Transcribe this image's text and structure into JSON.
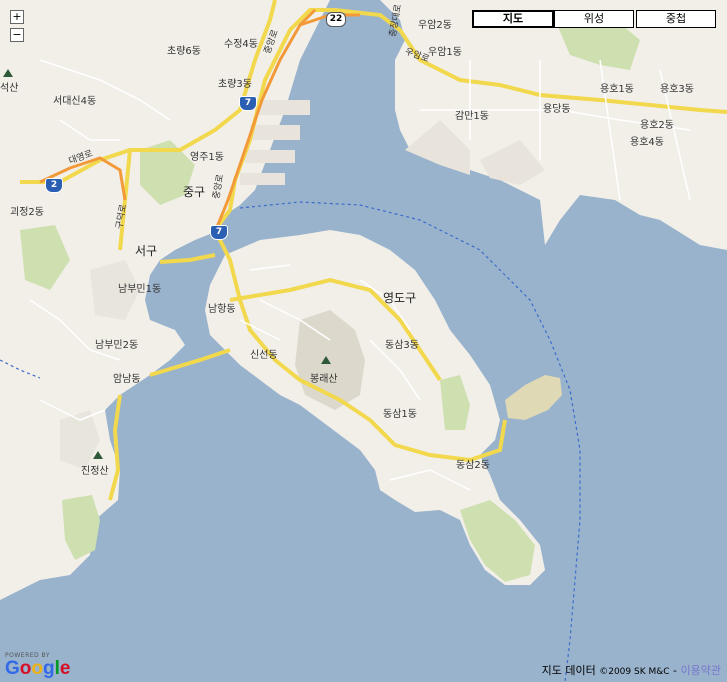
{
  "map_controls": {
    "zoom_in": "+",
    "zoom_out": "−",
    "map_types": [
      {
        "label": "지도",
        "active": true
      },
      {
        "label": "위성",
        "active": false
      },
      {
        "label": "중첩",
        "active": false
      }
    ]
  },
  "road_shields": [
    "22",
    "7",
    "7",
    "2"
  ],
  "place_labels": [
    {
      "name": "우암2동",
      "size": "small"
    },
    {
      "name": "수정4동",
      "size": "small"
    },
    {
      "name": "초량6동",
      "size": "small"
    },
    {
      "name": "우암1동",
      "size": "small"
    },
    {
      "name": "서대신4동",
      "size": "small"
    },
    {
      "name": "초량3동",
      "size": "small"
    },
    {
      "name": "감만1동",
      "size": "small"
    },
    {
      "name": "용당동",
      "size": "small"
    },
    {
      "name": "용호1동",
      "size": "small"
    },
    {
      "name": "용호3동",
      "size": "small"
    },
    {
      "name": "용호2동",
      "size": "small"
    },
    {
      "name": "용호4동",
      "size": "small"
    },
    {
      "name": "영주1동",
      "size": "small"
    },
    {
      "name": "중구",
      "size": "big"
    },
    {
      "name": "괴정2동",
      "size": "small"
    },
    {
      "name": "서구",
      "size": "big"
    },
    {
      "name": "남부민1동",
      "size": "small"
    },
    {
      "name": "영도구",
      "size": "big"
    },
    {
      "name": "남항동",
      "size": "small"
    },
    {
      "name": "남부민2동",
      "size": "small"
    },
    {
      "name": "동삼3동",
      "size": "small"
    },
    {
      "name": "신선동",
      "size": "small"
    },
    {
      "name": "봉래산",
      "size": "small"
    },
    {
      "name": "암남동",
      "size": "small"
    },
    {
      "name": "동삼1동",
      "size": "small"
    },
    {
      "name": "진정산",
      "size": "small"
    },
    {
      "name": "동삼2동",
      "size": "small"
    },
    {
      "name": "석산",
      "size": "small"
    }
  ],
  "road_labels": [
    "중앙로",
    "대영로",
    "충장대로",
    "우암로",
    "구덕로",
    "중앙로"
  ],
  "logo": {
    "powered_by": "POWERED BY",
    "brand": "Google"
  },
  "footer": {
    "data_label": "지도 데이터",
    "copyright": "©2009 SK M&C",
    "separator": "-",
    "terms_link": "이용약관"
  },
  "colors": {
    "water": "#99b3cc",
    "land": "#f2efe9",
    "park": "#cfe0b0",
    "major_road": "#f2d84d",
    "arterial": "#f29a3a",
    "ferry": "#3d6ccc"
  }
}
